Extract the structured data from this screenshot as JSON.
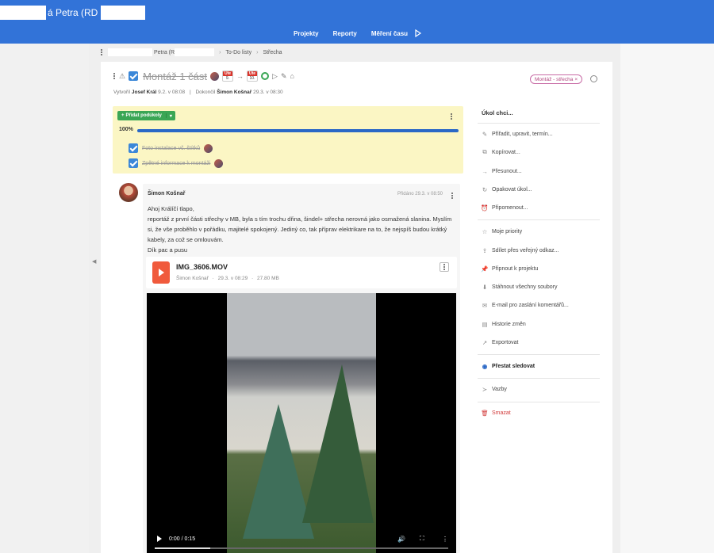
{
  "header": {
    "title_suffix": "á Petra (RD",
    "nav": [
      "Projekty",
      "Reporty",
      "Měření času"
    ],
    "play_icon": "play-icon"
  },
  "breadcrumb": {
    "project": "Petra (R",
    "list": "To-Do listy",
    "current": "Střecha"
  },
  "task": {
    "title": "Montáž 1 část",
    "start_day": "9.",
    "end_day": "10.",
    "cal_label": "Úte",
    "arrow": "→",
    "tag": "Montáž - střecha",
    "tag_close": "×",
    "created_label": "Vytvořil",
    "created_by": "Josef Král",
    "created_at": "9.2. v 08:08",
    "meta_sep": "|",
    "completed_label": "Dokončil",
    "completed_by": "Šimon Košnař",
    "completed_at": "29.3. v 08:30"
  },
  "checklist": {
    "add_label": "Přidat podúkoly",
    "add_plus": "+",
    "add_caret": "▾",
    "progress_label": "100%",
    "progress": 1.0,
    "items": [
      {
        "label": "Foto instalace vč. štítků"
      },
      {
        "label": "Zpětné informace k montáži"
      }
    ]
  },
  "comment": {
    "author": "Šimon Košnař",
    "added": "Přidáno 29.3. v 08:50",
    "lines": [
      "Ahoj Králíčí tlapo,",
      "reportáž z první části střechy v MB, byla s tím trochu dřina, šindel+ střecha nerovná jako osmažená slanina. Myslím si, že vše proběhlo v pořádku, majitelé spokojený. Jediný co, tak příprav elektrikare na to, že nejspíš budou krátký kabely, za což se omlouvám.",
      "Dík pac a pusu"
    ],
    "file": {
      "name": "IMG_3606.MOV",
      "author": "Šimon Košnař",
      "date": "29.3. v 08:29",
      "size": "27.80 MB",
      "sep": "·"
    },
    "video": {
      "time": "0:00 / 0:15",
      "progress": 0.19
    }
  },
  "menu": {
    "title": "Úkol chci...",
    "items": [
      {
        "label": "Přiřadit, upravit, termín...",
        "icon": "✎"
      },
      {
        "label": "Kopírovat...",
        "icon": "⧉"
      },
      {
        "label": "Přesunout...",
        "icon": "→"
      },
      {
        "label": "Opakovat úkol...",
        "icon": "↻"
      },
      {
        "label": "Připomenout...",
        "icon": "⏰"
      },
      {
        "label": "Moje priority",
        "icon": "☆"
      },
      {
        "label": "Sdílet přes veřejný odkaz...",
        "icon": "⇪"
      },
      {
        "label": "Připnout k projektu",
        "icon": "📌"
      },
      {
        "label": "Stáhnout všechny soubory",
        "icon": "⬇"
      },
      {
        "label": "E-mail pro zaslání komentářů...",
        "icon": "✉"
      },
      {
        "label": "Historie změn",
        "icon": "▤"
      },
      {
        "label": "Exportovat",
        "icon": "↗"
      },
      {
        "label": "Přestat sledovat",
        "icon": "◉"
      },
      {
        "label": "Vazby",
        "icon": "≻"
      },
      {
        "label": "Smazat",
        "icon": "🗑"
      }
    ]
  },
  "colors": {
    "brand": "#3273d8",
    "checklist_bg": "#fbf6c4",
    "progress": "#2a68c6",
    "green": "#3aa655",
    "danger": "#d23b3b"
  }
}
